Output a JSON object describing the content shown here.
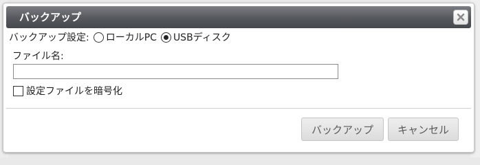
{
  "dialog": {
    "title": "バックアップ",
    "close_icon": "close-icon"
  },
  "backup_setting": {
    "label": "バックアップ設定:",
    "options": [
      {
        "label": "ローカルPC",
        "selected": false
      },
      {
        "label": "USBディスク",
        "selected": true
      }
    ]
  },
  "filename": {
    "label": "ファイル名:",
    "value": "",
    "placeholder": ""
  },
  "encrypt": {
    "label": "設定ファイルを暗号化",
    "checked": false
  },
  "buttons": {
    "backup_label": "バックアップ",
    "cancel_label": "キャンセル"
  }
}
